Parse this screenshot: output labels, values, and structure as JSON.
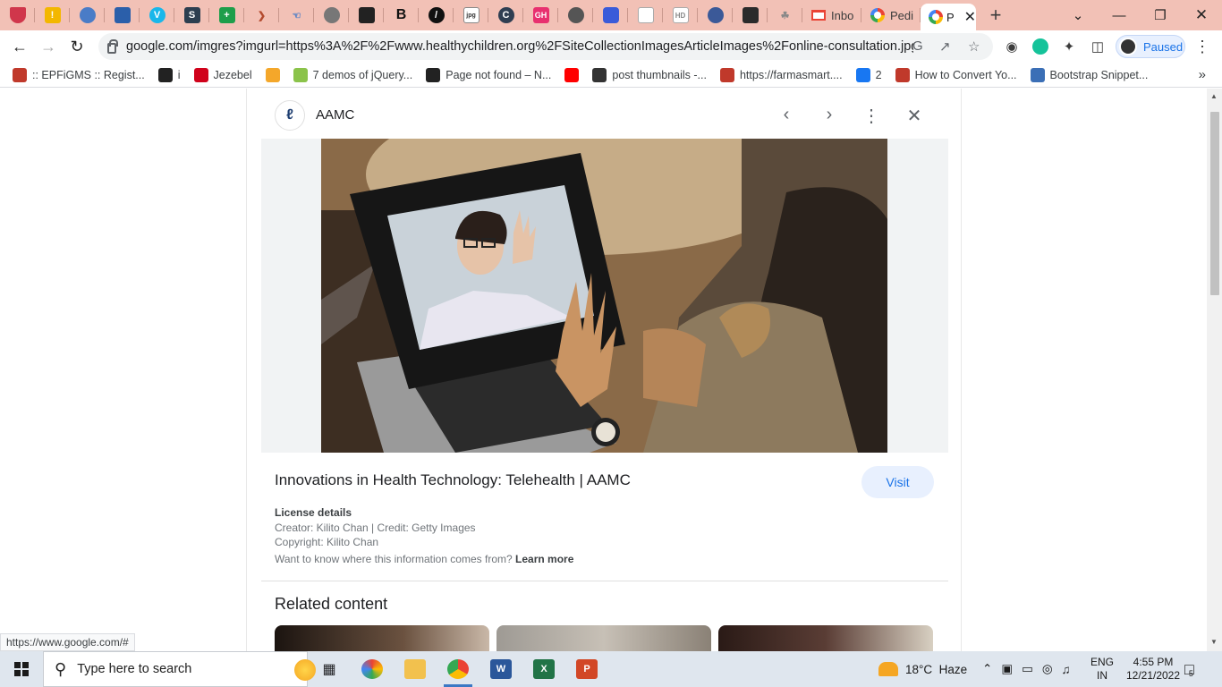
{
  "browser": {
    "tabs": [
      {
        "label": "Pedi",
        "icon": "google-icon"
      },
      {
        "label": "P",
        "icon": "google-icon",
        "active": true
      }
    ],
    "gmail_tab": "Inbo",
    "url": "google.com/imgres?imgurl=https%3A%2F%2Fwww.healthychildren.org%2FSiteCollectionImagesArticleImages%2Fonline-consultation.jpg...",
    "profile_status": "Paused",
    "status_url": "https://www.google.com/#"
  },
  "bookmarks": [
    {
      "label": ":: EPFiGMS :: Regist...",
      "icon": "epfigms-icon",
      "color": "#c0392b"
    },
    {
      "label": "i",
      "icon": "globe-icon",
      "color": "#222222"
    },
    {
      "label": "Jezebel",
      "icon": "jezebel-icon",
      "color": "#d0021b"
    },
    {
      "label": "",
      "icon": "pinwheel-icon",
      "color": "#f4a72a"
    },
    {
      "label": "7 demos of jQuery...",
      "icon": "jquery-icon",
      "color": "#8bc34a"
    },
    {
      "label": "Page not found – N...",
      "icon": "counter-icon",
      "color": "#222222"
    },
    {
      "label": "",
      "icon": "youtube-icon",
      "color": "#ff0000"
    },
    {
      "label": "post thumbnails -...",
      "icon": "wordpress-icon",
      "color": "#333333"
    },
    {
      "label": "https://farmasmart....",
      "icon": "farmasmart-icon",
      "color": "#c0392b"
    },
    {
      "label": "2",
      "icon": "facebook-icon",
      "color": "#1877f2"
    },
    {
      "label": "How to Convert Yo...",
      "icon": "pn-icon",
      "color": "#c0392b"
    },
    {
      "label": "Bootstrap Snippet...",
      "icon": "bootstrap-icon",
      "color": "#3b6fb6"
    }
  ],
  "panel": {
    "site_name": "AAMC",
    "title": "Innovations in Health Technology: Telehealth | AAMC",
    "visit_label": "Visit",
    "license_heading": "License details",
    "creator_line": "Creator: Kilito Chan | Credit: Getty Images",
    "copyright_line": "Copyright: Kilito Chan",
    "info_question": "Want to know where this information comes from?",
    "learn_more": "Learn more",
    "related_heading": "Related content"
  },
  "taskbar": {
    "search_placeholder": "Type here to search",
    "weather": "18°C  Haze",
    "lang_line1": "ENG",
    "lang_line2": "IN",
    "time": "4:55 PM",
    "date": "12/21/2022",
    "notification_count": "5"
  },
  "colors": {
    "tabstrip": "#f2c1b6",
    "accent": "#1a73e8",
    "visit_bg": "#e8f0fe"
  }
}
